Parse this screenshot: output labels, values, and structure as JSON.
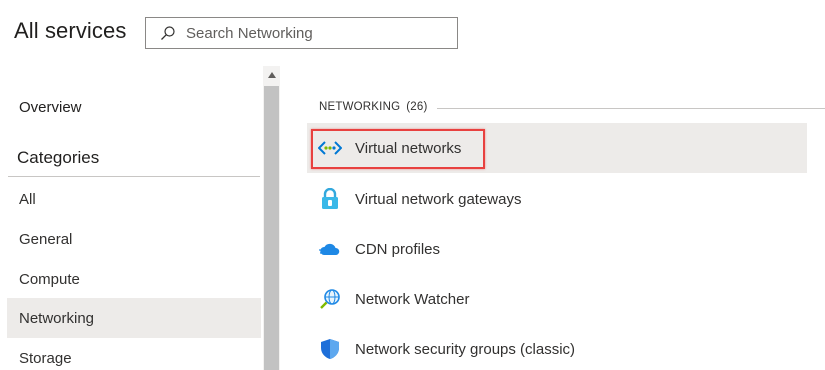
{
  "header": {
    "title": "All services",
    "search_placeholder": "Search Networking"
  },
  "left_nav": {
    "overview": "Overview",
    "categories_heading": "Categories",
    "items": [
      {
        "label": "All"
      },
      {
        "label": "General"
      },
      {
        "label": "Compute"
      },
      {
        "label": "Networking",
        "selected": true
      },
      {
        "label": "Storage"
      }
    ]
  },
  "section": {
    "title": "NETWORKING",
    "count": "(26)"
  },
  "services": [
    {
      "label": "Virtual networks",
      "icon": "virtual-network-icon",
      "selected": true
    },
    {
      "label": "Virtual network gateways",
      "icon": "lock-gateway-icon"
    },
    {
      "label": "CDN profiles",
      "icon": "cdn-cloud-icon"
    },
    {
      "label": "Network Watcher",
      "icon": "globe-magnifier-icon"
    },
    {
      "label": "Network security groups (classic)",
      "icon": "shield-icon"
    }
  ],
  "colors": {
    "accent_blue": "#0078d4",
    "highlight_red": "#e8413f",
    "selected_bg": "#edebe9"
  }
}
